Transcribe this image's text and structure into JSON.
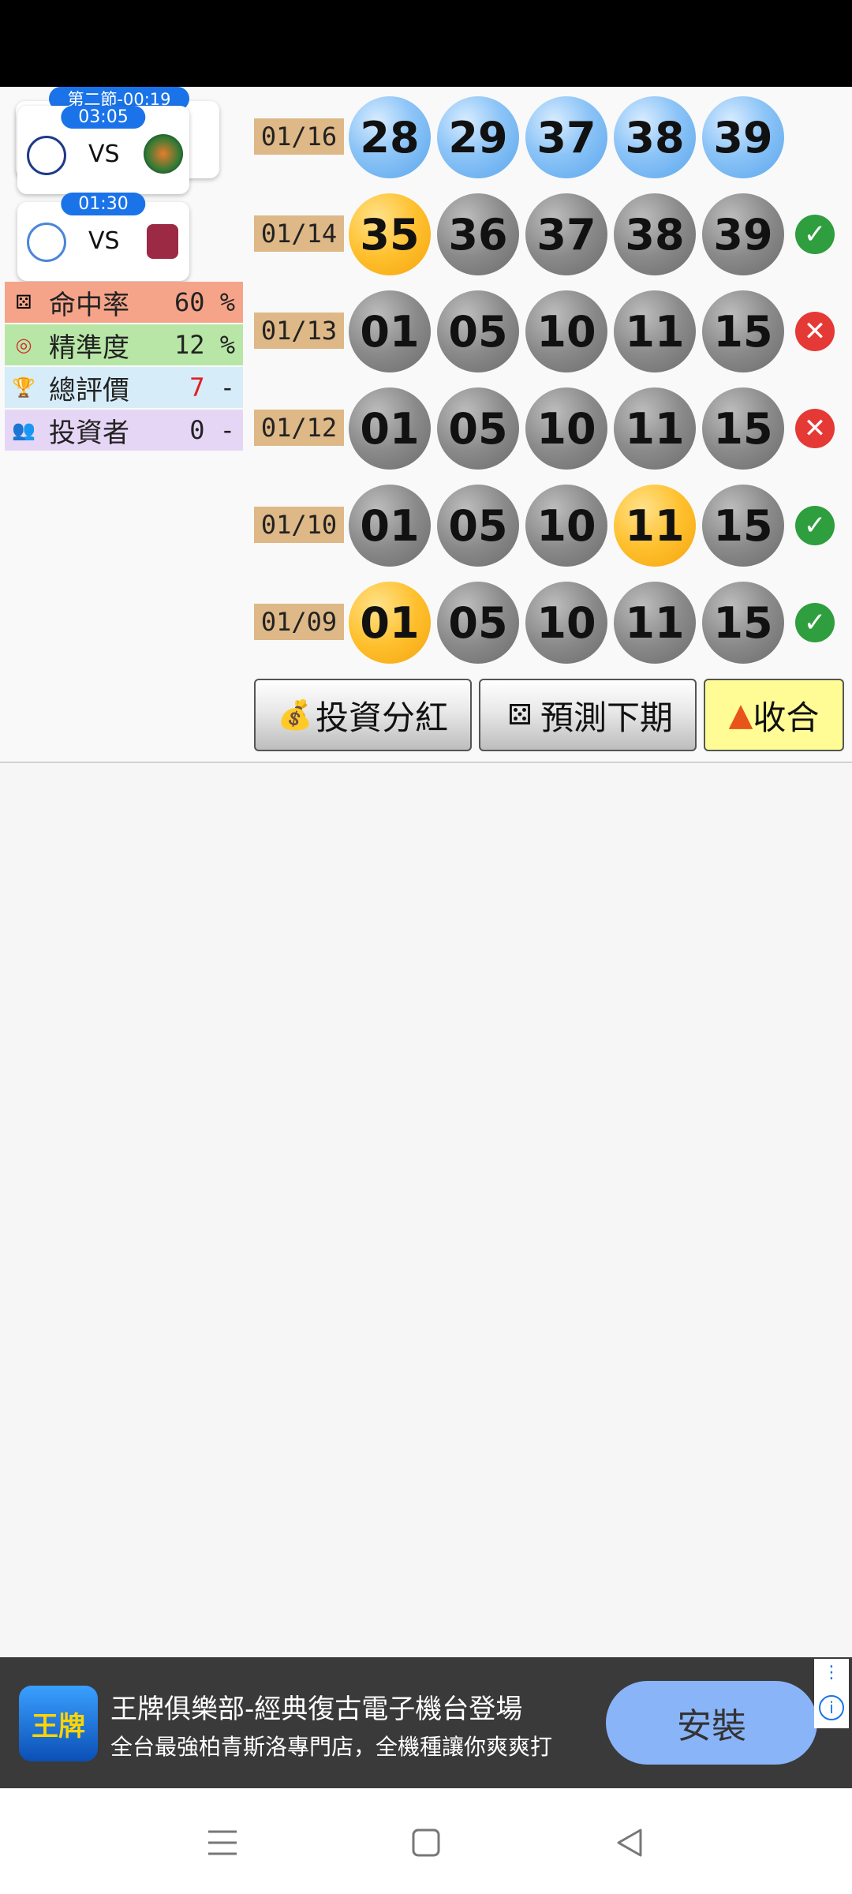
{
  "matches": [
    {
      "header": "第二節-00:19",
      "time": "03:05",
      "vs": "VS"
    },
    {
      "time": "01:30",
      "vs": "VS"
    }
  ],
  "stats": [
    {
      "label": "命中率",
      "value": "60 %",
      "value_color": "#222222",
      "suffix": "",
      "bg": "#f5a48a",
      "icon": "dice-icon"
    },
    {
      "label": "精準度",
      "value": "12 %",
      "value_color": "#222222",
      "suffix": "",
      "bg": "#b8e6a6",
      "icon": "target-icon"
    },
    {
      "label": "總評價",
      "value": "7",
      "value_color": "#e02020",
      "suffix": " -",
      "bg": "#d6ecf8",
      "icon": "trophy-icon"
    },
    {
      "label": "投資者",
      "value": "0",
      "value_color": "#222222",
      "suffix": " -",
      "bg": "#e6d6f5",
      "icon": "people-icon"
    }
  ],
  "draws": [
    {
      "date": "01/16",
      "balls": [
        "28",
        "29",
        "37",
        "38",
        "39"
      ],
      "colors": [
        "blue",
        "blue",
        "blue",
        "blue",
        "blue"
      ],
      "result": "none"
    },
    {
      "date": "01/14",
      "balls": [
        "35",
        "36",
        "37",
        "38",
        "39"
      ],
      "colors": [
        "gold",
        "gray",
        "gray",
        "gray",
        "gray"
      ],
      "result": "ok"
    },
    {
      "date": "01/13",
      "balls": [
        "01",
        "05",
        "10",
        "11",
        "15"
      ],
      "colors": [
        "gray",
        "gray",
        "gray",
        "gray",
        "gray"
      ],
      "result": "bad"
    },
    {
      "date": "01/12",
      "balls": [
        "01",
        "05",
        "10",
        "11",
        "15"
      ],
      "colors": [
        "gray",
        "gray",
        "gray",
        "gray",
        "gray"
      ],
      "result": "bad"
    },
    {
      "date": "01/10",
      "balls": [
        "01",
        "05",
        "10",
        "11",
        "15"
      ],
      "colors": [
        "gray",
        "gray",
        "gray",
        "gold",
        "gray"
      ],
      "result": "ok"
    },
    {
      "date": "01/09",
      "balls": [
        "01",
        "05",
        "10",
        "11",
        "15"
      ],
      "colors": [
        "gold",
        "gray",
        "gray",
        "gray",
        "gray"
      ],
      "result": "ok"
    }
  ],
  "buttons": {
    "invest": "投資分紅",
    "predict": "預測下期",
    "collapse": "收合",
    "collapse_glyph": "▲"
  },
  "ad": {
    "logo_text": "王牌",
    "title": "王牌俱樂部-經典復古電子機台登場",
    "subtitle": "全台最強柏青斯洛專門店，全機種讓你爽爽打",
    "install": "安裝"
  }
}
